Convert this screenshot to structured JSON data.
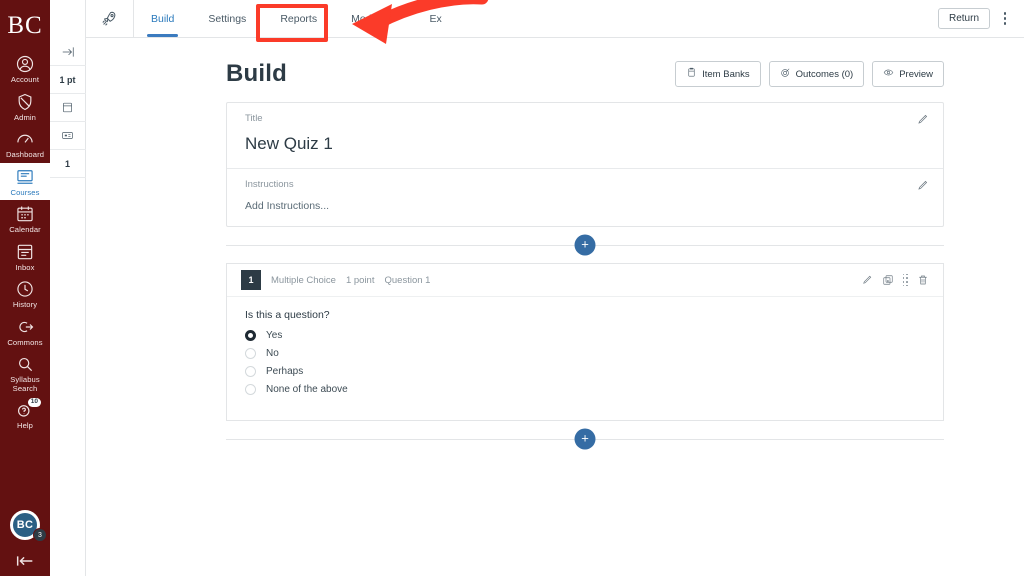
{
  "globalnav": {
    "brand": "BC",
    "items": [
      {
        "label": "Account",
        "icon": "user-circle-icon",
        "active": false
      },
      {
        "label": "Admin",
        "icon": "shield-icon",
        "active": false
      },
      {
        "label": "Dashboard",
        "icon": "dashboard-icon",
        "active": false
      },
      {
        "label": "Courses",
        "icon": "courses-icon",
        "active": true
      },
      {
        "label": "Calendar",
        "icon": "calendar-icon",
        "active": false
      },
      {
        "label": "Inbox",
        "icon": "inbox-icon",
        "active": false
      },
      {
        "label": "History",
        "icon": "clock-icon",
        "active": false
      },
      {
        "label": "Commons",
        "icon": "commons-icon",
        "active": false
      },
      {
        "label": "Syllabus Search",
        "icon": "search-icon",
        "active": false
      },
      {
        "label": "Help",
        "icon": "help-icon",
        "active": false,
        "badge": "10"
      }
    ],
    "avatar_initials": "BC",
    "avatar_badge": "3",
    "collapse_icon": "collapse-left-icon"
  },
  "rail": {
    "cells": [
      {
        "type": "icon",
        "icon": "expand-right-icon",
        "value": ""
      },
      {
        "type": "text",
        "icon": "",
        "value": "1 pt"
      },
      {
        "type": "icon",
        "icon": "page-icon",
        "value": ""
      },
      {
        "type": "icon",
        "icon": "media-icon",
        "value": ""
      },
      {
        "type": "text",
        "icon": "",
        "value": "1"
      }
    ]
  },
  "topbar": {
    "rocket_icon": "rocket-icon",
    "tabs": [
      {
        "label": "Build",
        "active": true
      },
      {
        "label": "Settings",
        "active": false
      },
      {
        "label": "Reports",
        "active": false
      },
      {
        "label": "Moderate",
        "active": false
      },
      {
        "label": "Ex",
        "active": false
      }
    ],
    "return_label": "Return",
    "kebab_icon": "more-options-icon"
  },
  "page": {
    "title": "Build",
    "actions": [
      {
        "label": "Item Banks",
        "icon": "item-bank-icon"
      },
      {
        "label": "Outcomes (0)",
        "icon": "outcomes-target-icon"
      },
      {
        "label": "Preview",
        "icon": "eye-icon"
      }
    ]
  },
  "quiz": {
    "title_label": "Title",
    "title_value": "New Quiz 1",
    "instructions_label": "Instructions",
    "instructions_placeholder": "Add Instructions...",
    "edit_icon": "pencil-icon",
    "add_button_label": "+"
  },
  "question": {
    "number": "1",
    "type": "Multiple Choice",
    "points": "1 point",
    "name": "Question 1",
    "text": "Is this a question?",
    "actions": [
      {
        "icon": "pencil-icon"
      },
      {
        "icon": "duplicate-icon"
      },
      {
        "icon": "drag-handle-icon"
      },
      {
        "icon": "trash-icon"
      }
    ],
    "options": [
      {
        "label": "Yes",
        "selected": true
      },
      {
        "label": "No",
        "selected": false
      },
      {
        "label": "Perhaps",
        "selected": false
      },
      {
        "label": "None of the above",
        "selected": false
      }
    ]
  },
  "annotation": {
    "highlight_target": "Moderate",
    "color": "#fb3b29",
    "shape": "rectangle-with-arrow"
  },
  "colors": {
    "nav_maroon": "#631111",
    "accent_blue": "#2b7abc",
    "fab_blue": "#356ca4",
    "dark_slate": "#2d3b45",
    "annotation_red": "#fb3b29"
  }
}
